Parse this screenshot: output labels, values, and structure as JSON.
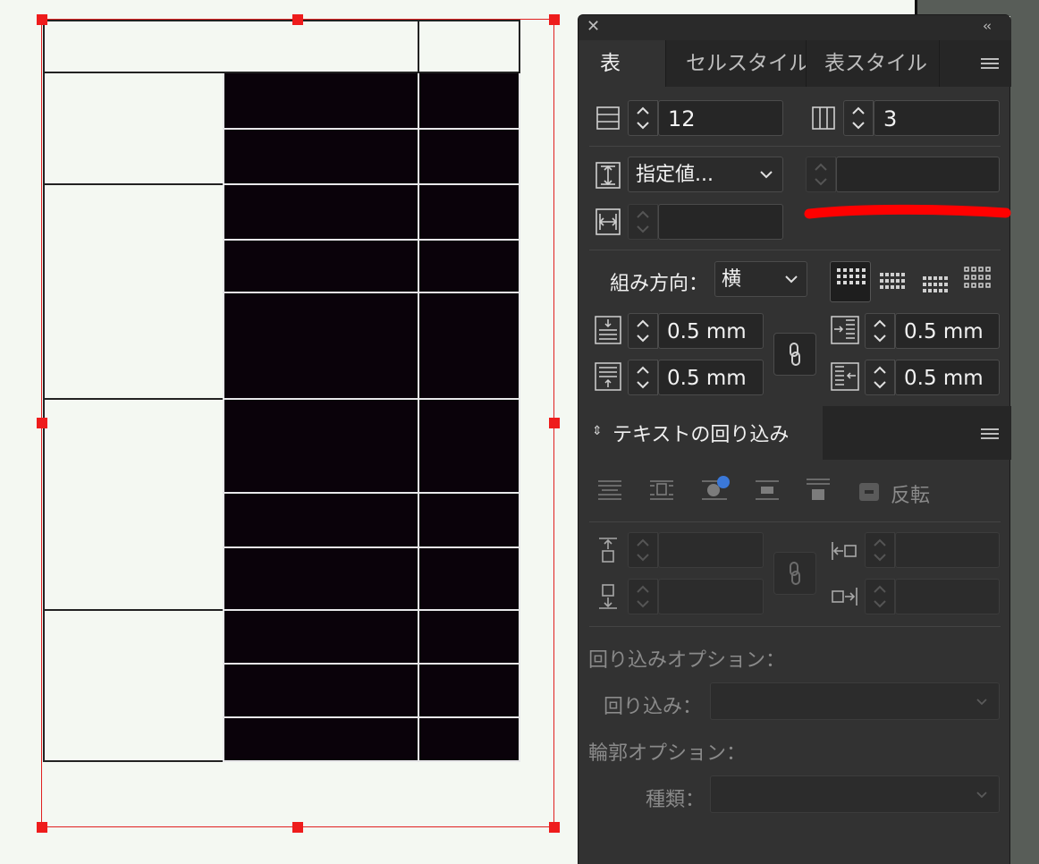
{
  "panel": {
    "tabs": [
      {
        "label": "表",
        "active": true
      },
      {
        "label": "セルスタイル",
        "active": false
      },
      {
        "label": "表スタイル",
        "active": false
      }
    ],
    "table_options": {
      "rows_value": "12",
      "columns_value": "3",
      "row_height_mode": "指定値...",
      "row_height_value": "",
      "column_width_value": ""
    },
    "direction": {
      "label": "組み方向：",
      "value": "横"
    },
    "insets": {
      "top": "0.5 mm",
      "bottom": "0.5 mm",
      "left": "0.5 mm",
      "right": "0.5 mm"
    },
    "text_wrap": {
      "title": "テキストの回り込み",
      "invert_label": "反転",
      "wrap_options_heading": "回り込みオプション：",
      "wrap_label": "回り込み：",
      "wrap_value": "",
      "contour_heading": "輪郭オプション：",
      "type_label": "種類：",
      "type_value": ""
    }
  },
  "colors": {
    "panel_bg": "#323232",
    "table_fill": "#0a020a",
    "selection": "#e02020",
    "annotation": "#ff0000",
    "accent_dot": "#3b78d8"
  }
}
